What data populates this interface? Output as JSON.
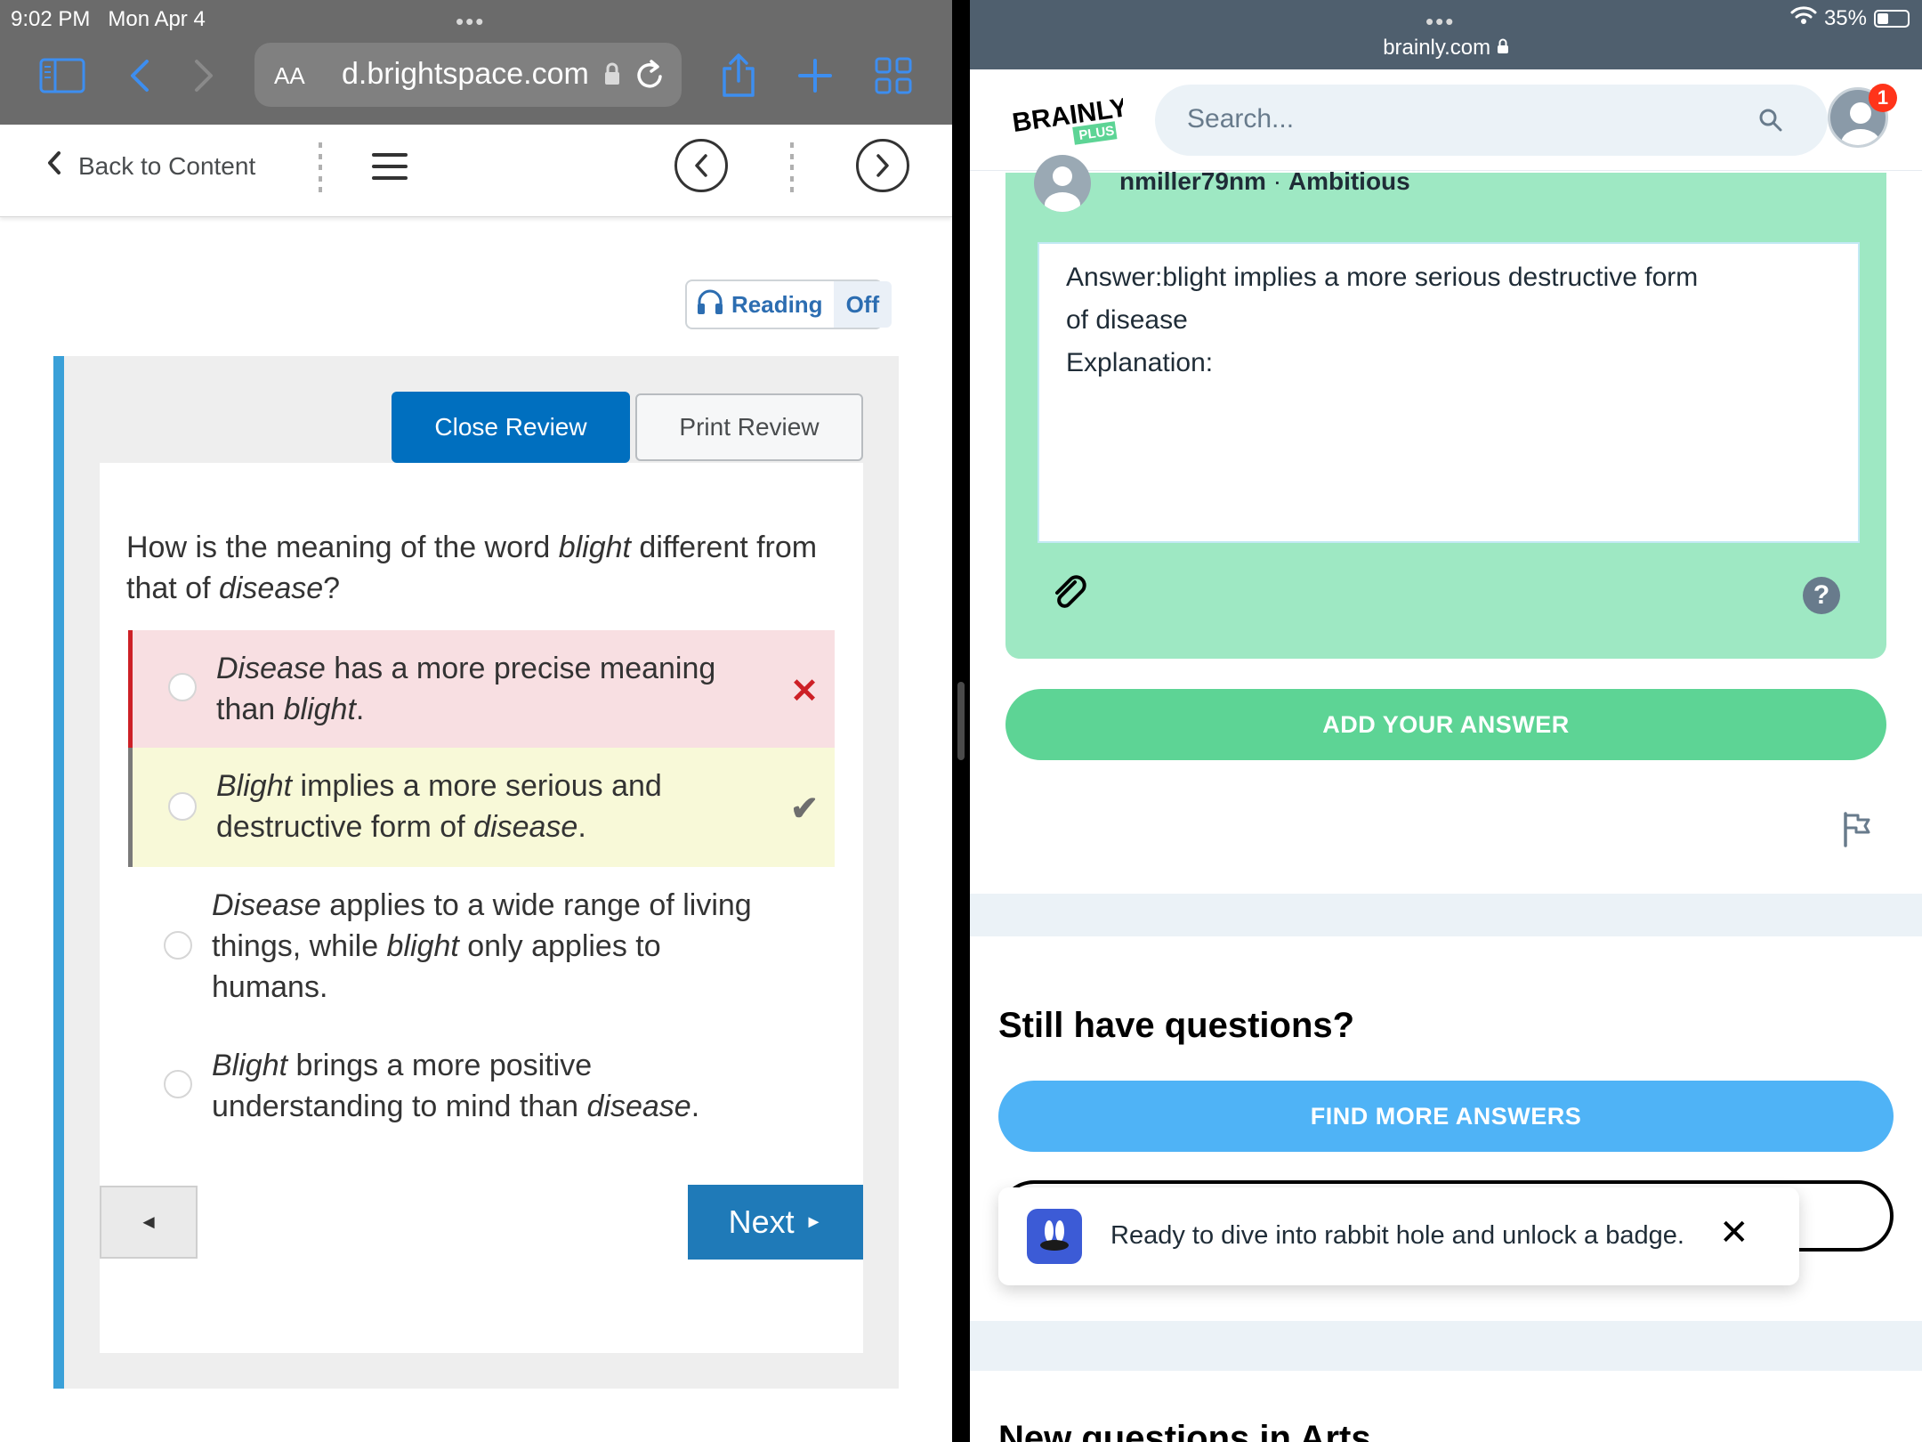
{
  "left": {
    "status": {
      "time": "9:02 PM",
      "date": "Mon Apr 4"
    },
    "toolbar": {
      "text_size": "AA",
      "url": "d.brightspace.com"
    },
    "nav": {
      "back_label": "Back to Content"
    },
    "reading": {
      "label": "Reading",
      "state": "Off"
    },
    "review": {
      "close_label": "Close Review",
      "print_label": "Print Review"
    },
    "question": {
      "pre": "How is the meaning of the word ",
      "word1": "blight",
      "mid": " different from that of ",
      "word2": "disease",
      "post": "?"
    },
    "options": [
      {
        "em1": "Disease",
        "t1": " has a more precise meaning than ",
        "em2": "blight",
        "t2": ".",
        "status": "wrong",
        "mark": "✕"
      },
      {
        "em1": "Blight",
        "t1": " implies a more serious and destructive form of ",
        "em2": "disease",
        "t2": ".",
        "status": "correct",
        "mark": "✔"
      },
      {
        "em1": "Disease",
        "t1": " applies to a wide range of living things, while ",
        "em2": "blight",
        "t2": " only applies to humans.",
        "status": "none"
      },
      {
        "em1": "Blight",
        "t1": " brings a more positive understanding to mind than ",
        "em2": "disease",
        "t2": ".",
        "status": "none"
      }
    ],
    "pager": {
      "prev_label": "◄",
      "next_label": "Next",
      "next_arrow": "►"
    }
  },
  "right": {
    "status": {
      "wifi": "wifi-icon",
      "battery": "35%",
      "url": "brainly.com"
    },
    "header": {
      "logo_text": "BRAINLY",
      "logo_sub": "PLUS",
      "search_placeholder": "Search...",
      "notification_count": "1"
    },
    "answer": {
      "username": "nmiller79nm",
      "rank": "Ambitious",
      "line1": "Answer:blight implies a more serious destructive form",
      "line2": "of disease",
      "line3": "Explanation:"
    },
    "add_answer_label": "ADD YOUR ANSWER",
    "still_questions": "Still have questions?",
    "find_more_label": "FIND MORE ANSWERS",
    "toast": {
      "text": "Ready to dive into rabbit hole and unlock a badge.",
      "close": "✕"
    },
    "new_questions": "New questions in Arts"
  },
  "colors": {
    "d2l_blue": "#006fbf",
    "wrong_bg": "#f8dfe2",
    "wrong_mark": "#cd2026",
    "correct_bg": "#f8f9d8",
    "brainly_green": "#5dd495",
    "brainly_card": "#9ee8c3",
    "brainly_blue": "#4fb3f6"
  }
}
